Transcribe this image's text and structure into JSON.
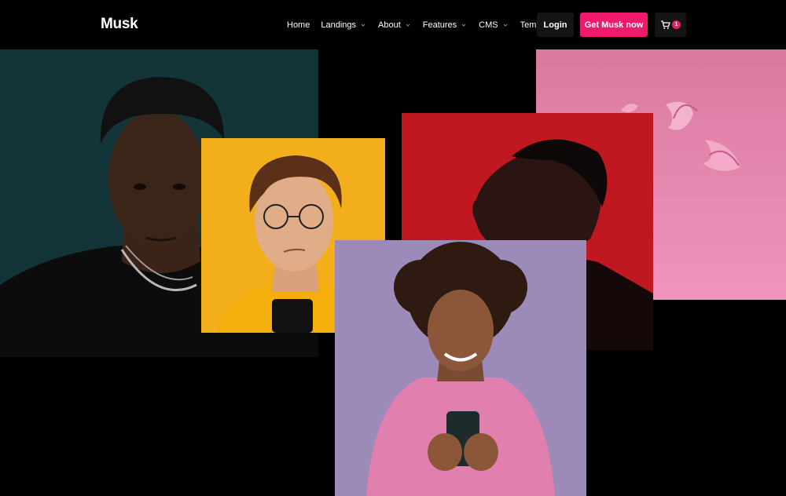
{
  "brand": {
    "name": "Musk"
  },
  "nav": {
    "items": [
      {
        "label": "Home",
        "has_dropdown": false
      },
      {
        "label": "Landings",
        "has_dropdown": true
      },
      {
        "label": "About",
        "has_dropdown": true
      },
      {
        "label": "Features",
        "has_dropdown": true
      },
      {
        "label": "CMS",
        "has_dropdown": true
      },
      {
        "label": "Template",
        "has_dropdown": true
      }
    ],
    "login_label": "Login",
    "cta_label": "Get Musk now",
    "cart_count": "1"
  },
  "colors": {
    "background": "#000000",
    "accent": "#ef1a6b",
    "button_dark": "#141414"
  },
  "gallery": {
    "photos": [
      {
        "name": "man-teal-background",
        "background": "#13353a"
      },
      {
        "name": "man-glasses-yellow-background",
        "background": "#f3ae1c"
      },
      {
        "name": "man-profile-red-background",
        "background": "#c01820"
      },
      {
        "name": "pink-petals-background",
        "background": "#e58bb0"
      },
      {
        "name": "woman-phone-purple-background",
        "background": "#9c8ab8"
      }
    ]
  }
}
